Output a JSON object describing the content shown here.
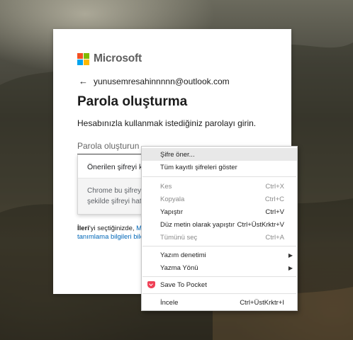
{
  "brand": {
    "name": "Microsoft",
    "colors": [
      "#f25022",
      "#7fba00",
      "#00a4ef",
      "#ffb900"
    ]
  },
  "account": {
    "email": "yunusemresahinnnnn@outlook.com"
  },
  "card": {
    "title": "Parola oluşturma",
    "description": "Hesabınızla kullanmak istediğiniz parolayı girin.",
    "password_placeholder": "Parola oluşturun"
  },
  "suggestion": {
    "top_text": "Önerilen şifreyi ku",
    "body_line1": "Chrome bu şifreyi",
    "body_line2": "şekilde şifreyi hatı"
  },
  "legal": {
    "bold": "İleri",
    "line1_rest": "'yi seçtiğinizde,",
    "line1_link": "Mi",
    "line2_link": "tanımlama bilgileri bild"
  },
  "context_menu": {
    "items": [
      {
        "label": "Şifre öner...",
        "shortcut": "",
        "disabled": false,
        "highlighted": true
      },
      {
        "label": "Tüm kayıtlı şifreleri göster",
        "shortcut": "",
        "disabled": false
      },
      {
        "label": "Kes",
        "shortcut": "Ctrl+X",
        "disabled": true
      },
      {
        "label": "Kopyala",
        "shortcut": "Ctrl+C",
        "disabled": true
      },
      {
        "label": "Yapıştır",
        "shortcut": "Ctrl+V",
        "disabled": false
      },
      {
        "label": "Düz metin olarak yapıştır",
        "shortcut": "Ctrl+ÜstKrktr+V",
        "disabled": false
      },
      {
        "label": "Tümünü seç",
        "shortcut": "Ctrl+A",
        "disabled": true
      },
      {
        "label": "Yazım denetimi",
        "submenu": true
      },
      {
        "label": "Yazma Yönü",
        "submenu": true
      },
      {
        "label": "Save To Pocket",
        "icon": "pocket-icon"
      },
      {
        "label": "İncele",
        "shortcut": "Ctrl+ÜstKrktr+I",
        "disabled": false
      }
    ]
  }
}
